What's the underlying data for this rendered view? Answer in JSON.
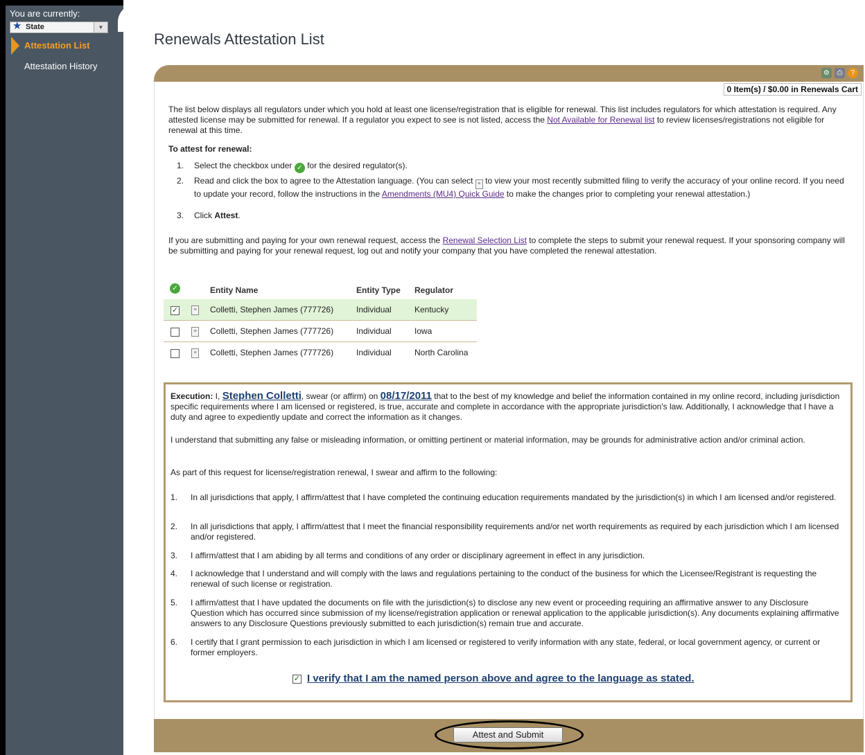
{
  "sidebar": {
    "you_are_currently": "You are currently:",
    "state_label": "State",
    "items": [
      {
        "label": "Attestation List",
        "active": true
      },
      {
        "label": "Attestation History",
        "active": false
      }
    ]
  },
  "page_title": "Renewals Attestation List",
  "cart": "0 Item(s) / $0.00 in Renewals Cart",
  "intro": {
    "text_before_link": "The list below displays all regulators under which you hold at least one license/registration that is eligible for renewal. This list includes regulators for which attestation is required. Any attested license may be submitted for renewal. If a regulator you expect to see is not listed, access the ",
    "link": "Not Available for Renewal list",
    "text_after_link": " to review licenses/registrations not eligible for renewal at this time."
  },
  "to_attest_heading": "To attest for renewal:",
  "steps": [
    {
      "num": "1.",
      "a": "Select the checkbox under ",
      "b": " for the desired regulator(s)."
    },
    {
      "num": "2.",
      "a": "Read and click the box to agree to the Attestation language. (You can select ",
      "b": " to view your most recently submitted filing to verify the accuracy of your online record. If you need to update your record, follow the instructions in the ",
      "link": "Amendments (MU4) Quick Guide",
      "c": " to make the changes prior to completing your renewal attestation.)"
    },
    {
      "num": "3.",
      "a": "Click ",
      "bold": "Attest",
      "b": "."
    }
  ],
  "submitting": {
    "a": "If you are submitting and paying for your own renewal request, access the ",
    "link": "Renewal Selection List",
    "b": " to complete the steps to submit your renewal request. If your sponsoring company will be submitting and paying for your renewal request, log out and notify your company that you have completed the renewal attestation."
  },
  "table": {
    "headers": {
      "entity_name": "Entity Name",
      "entity_type": "Entity Type",
      "regulator": "Regulator"
    },
    "rows": [
      {
        "checked": true,
        "entity_name": "Colletti, Stephen James (777726)",
        "entity_type": "Individual",
        "regulator": "Kentucky"
      },
      {
        "checked": false,
        "entity_name": "Colletti, Stephen James (777726)",
        "entity_type": "Individual",
        "regulator": "Iowa"
      },
      {
        "checked": false,
        "entity_name": "Colletti, Stephen James (777726)",
        "entity_type": "Individual",
        "regulator": "North Carolina"
      }
    ]
  },
  "execution": {
    "label": "Execution:",
    "i_text": " I, ",
    "name": "Stephen Colletti",
    "swear": ", swear (or affirm) on ",
    "date": "08/17/2011",
    "rest": " that to the best of my knowledge and belief the information contained in my online record, including jurisdiction specific requirements where I am licensed or registered, is true, accurate and complete in accordance with the appropriate jurisdiction's law. Additionally, I acknowledge that I have a duty and agree to expediently update and correct the information as it changes.",
    "understand": "I understand that submitting any false or misleading information, or omitting pertinent or material information, may be grounds for administrative action and/or criminal action.",
    "as_part": "As part of this request for license/registration renewal, I swear and affirm to the following:",
    "items": [
      {
        "num": "1.",
        "text": "In all jurisdictions that apply, I affirm/attest that I have completed the continuing education requirements mandated by the jurisdiction(s) in which I am licensed and/or registered."
      },
      {
        "num": "2.",
        "text": "In all jurisdictions that apply, I affirm/attest that I meet the financial responsibility requirements and/or net worth requirements as required by each jurisdiction which I am licensed and/or registered."
      },
      {
        "num": "3.",
        "text": "I affirm/attest that I am abiding by all terms and conditions of any order or disciplinary agreement in effect in any jurisdiction."
      },
      {
        "num": "4.",
        "text": "I acknowledge that I understand and will comply with the laws and regulations pertaining to the conduct of the business for which the Licensee/Registrant is requesting the renewal of such license or registration."
      },
      {
        "num": "5.",
        "text": "I affirm/attest that I have updated the documents on file with the jurisdiction(s) to disclose any new event or proceeding requiring an affirmative answer to any Disclosure Question which has occurred since submission of my license/registration application or renewal application to the applicable jurisdiction(s). Any documents explaining affirmative answers to any Disclosure Questions previously submitted to each jurisdiction(s) remain true and accurate."
      },
      {
        "num": "6.",
        "text": "I certify that I grant permission to each jurisdiction in which I am licensed or registered to verify information with any state, federal, or local government agency, or current or former employers."
      }
    ],
    "verify_label": "I verify that I am the named person above and agree to the language as stated.",
    "verify_checked": true
  },
  "submit_button": "Attest and Submit",
  "colors": {
    "sidebar": "#4a5661",
    "accent": "#a89064",
    "active_nav": "#f0a030",
    "link": "#5a2a8a"
  }
}
